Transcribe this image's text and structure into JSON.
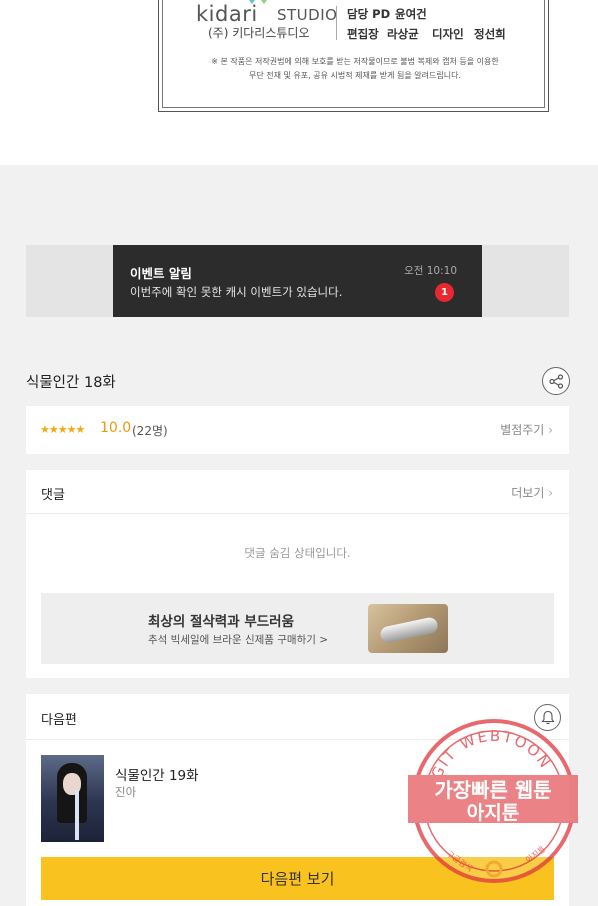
{
  "credits": {
    "logo_brand": "kidari",
    "logo_studio": "STUDIO",
    "company": "(주) 키다리스튜디오",
    "pd_label": "담당 PD",
    "pd_name": "윤여건",
    "editor_label": "편집장",
    "editor_name": "라상균",
    "designer_label": "디자인",
    "designer_name": "정선희",
    "notice_line1": "※ 본 작품은 저작권법에 의해 보호를 받는 저작물이므로 불법 복제와 캡처 등을 이용한",
    "notice_line2": "무단 전재 및 유포, 공유 시법적 제재를 받게 됨을 알려드립니다."
  },
  "banner": {
    "title": "이벤트 알림",
    "text": "이번주에 확인 못한 캐시 이벤트가 있습니다.",
    "time": "오전 10:10",
    "badge": "1"
  },
  "episode": {
    "title": "식물인간 18화"
  },
  "rating": {
    "stars": "★★★★★",
    "score": "10.0",
    "count": "(22명)",
    "rate_link": "별점주기"
  },
  "comments": {
    "title": "댓글",
    "more": "더보기",
    "hidden_text": "댓글 숨김 상태입니다."
  },
  "ad": {
    "title": "최상의 절삭력과 부드러움",
    "subtitle": "추석 빅세일에 브라운 신제품 구매하기 >"
  },
  "next": {
    "header": "다음편",
    "episode_title": "식물인간 19화",
    "author": "진아",
    "button_label": "다음편 보기"
  },
  "watermark": {
    "ring_text": "AGIT WEBTOON",
    "line1": "가장빠른 웹툰",
    "line2": "아지툰",
    "bottom_left": "구글검색",
    "bottom_right": "아지툰"
  },
  "colors": {
    "accent_yellow": "#f9c21f",
    "badge_red": "#e8282e",
    "star_orange": "#f1a918",
    "stamp_red": "#e0383e"
  },
  "icons": {
    "share": "share-icon",
    "bell": "bell-icon",
    "chevron": "chevron-right-icon"
  }
}
